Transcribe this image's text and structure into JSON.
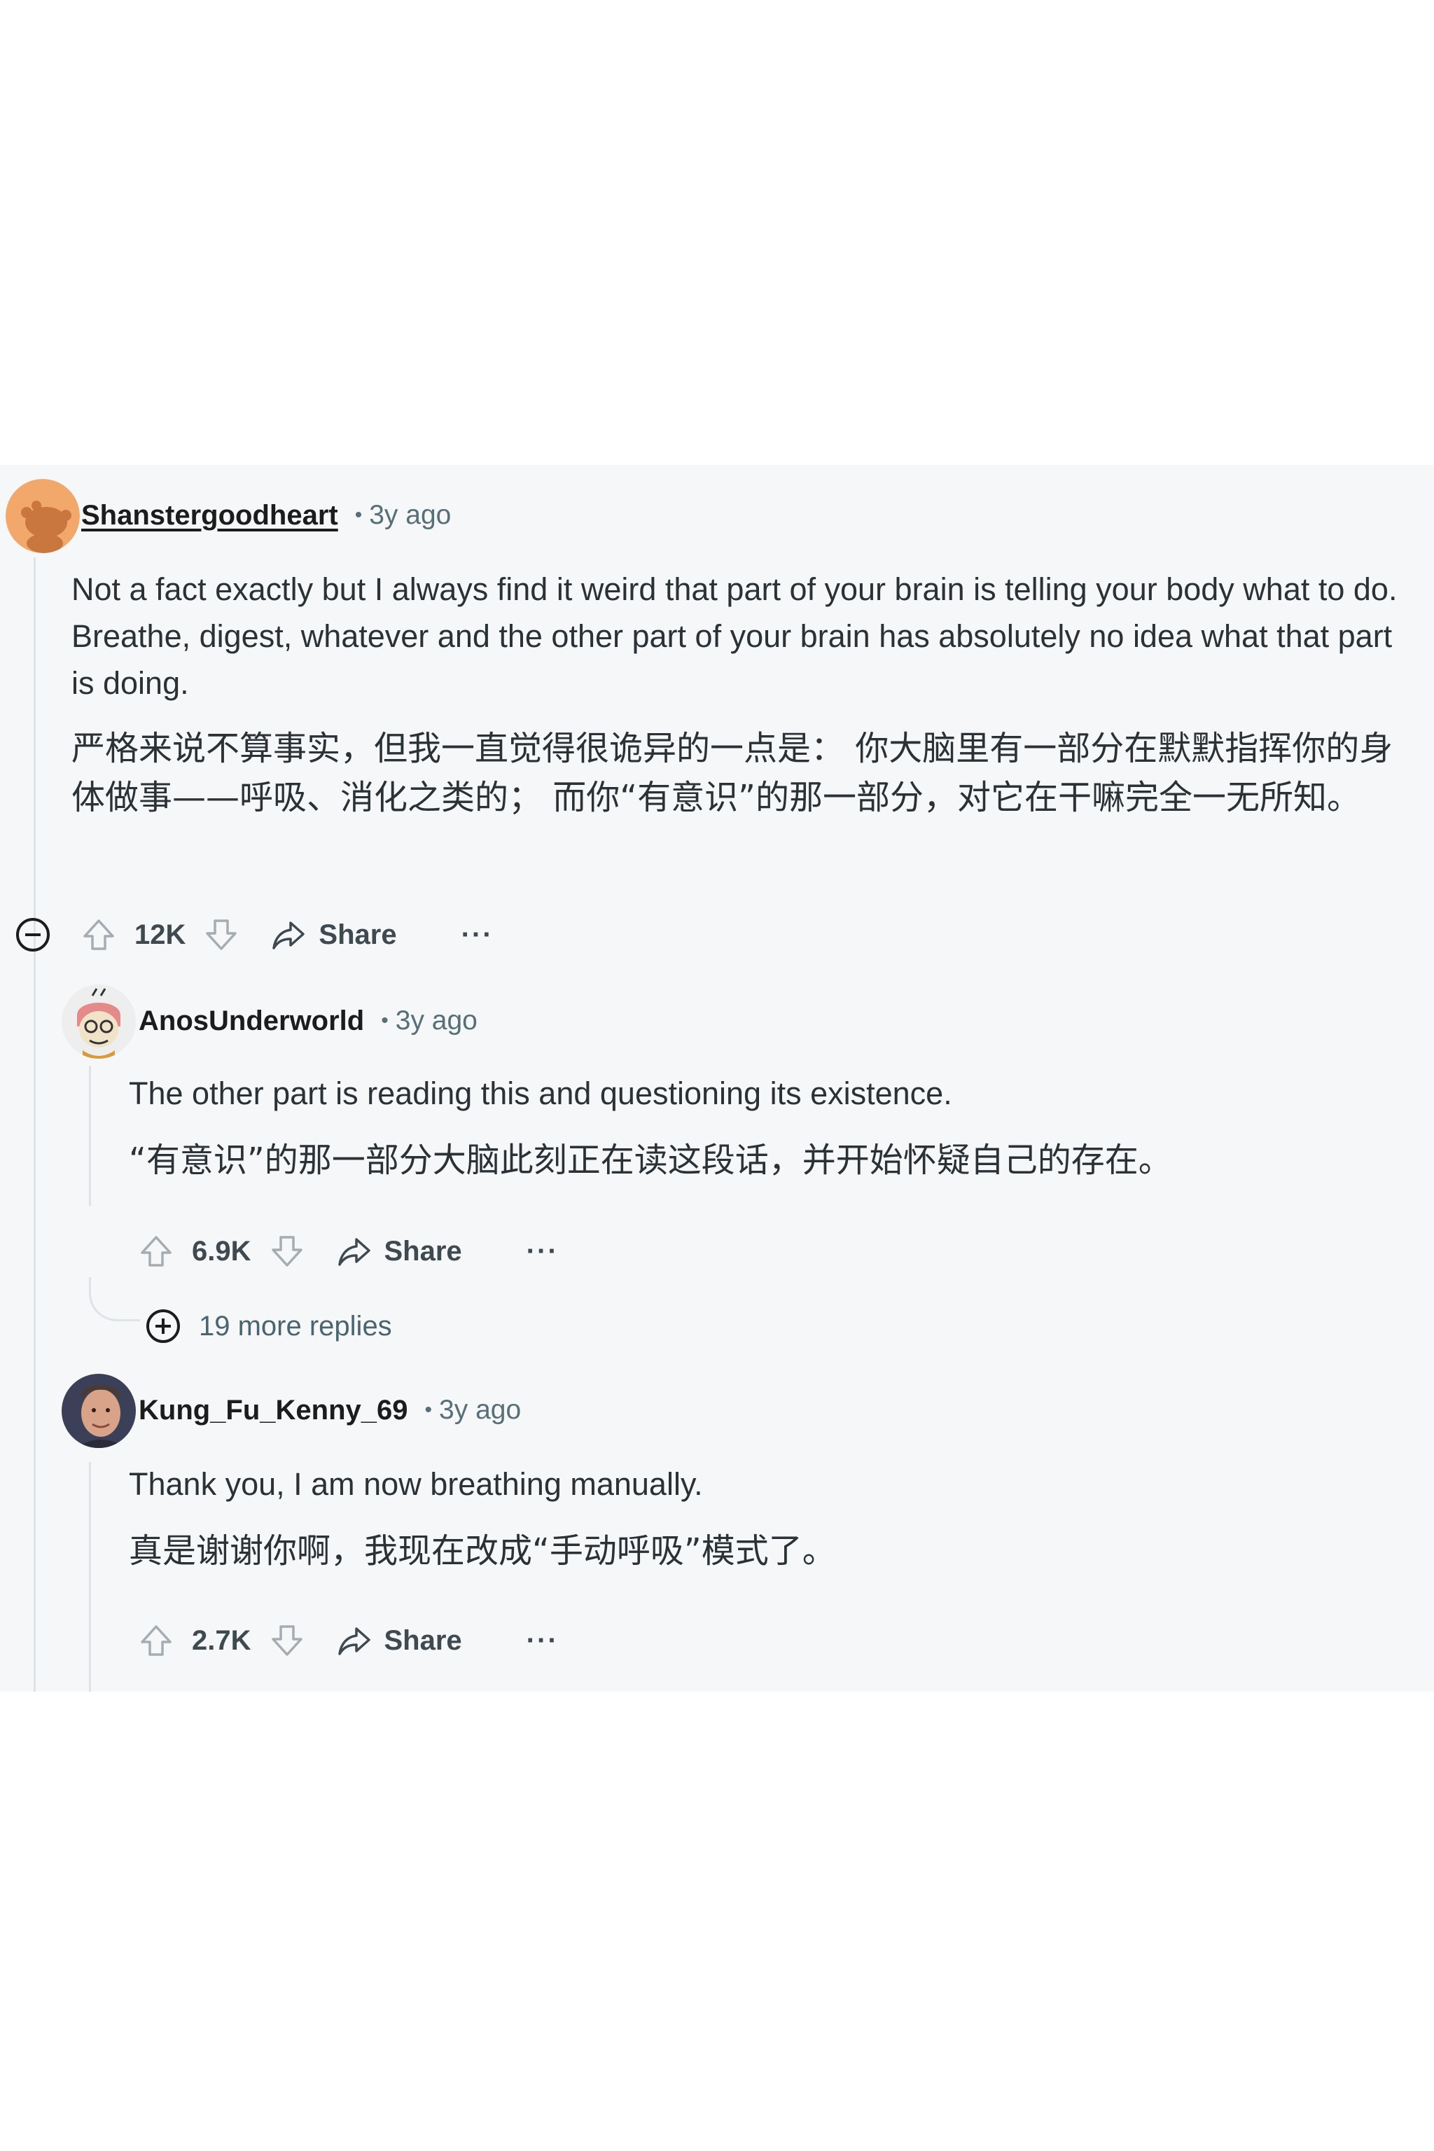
{
  "comments": [
    {
      "username": "Shanstergoodheart",
      "separator": "•",
      "time": "3y ago",
      "text_en": "Not a fact exactly but I always find it weird that part of your brain is telling your body what to do. Breathe, digest, whatever and the other part of your brain has absolutely no idea what that part is doing.",
      "text_zh": "严格来说不算事实，但我一直觉得很诡异的一点是： 你大脑里有一部分在默默指挥你的身体做事——呼吸、消化之类的； 而你“有意识”的那一部分，对它在干嘛完全一无所知。",
      "votes": "12K",
      "share_label": "Share",
      "more_label": "···"
    },
    {
      "username": "AnosUnderworld",
      "separator": "•",
      "time": "3y ago",
      "text_en": "The other part is reading this and questioning its existence.",
      "text_zh": "“有意识”的那一部分大脑此刻正在读这段话，并开始怀疑自己的存在。",
      "votes": "6.9K",
      "share_label": "Share",
      "more_label": "···",
      "more_replies": "19 more replies"
    },
    {
      "username": "Kung_Fu_Kenny_69",
      "separator": "•",
      "time": "3y ago",
      "text_en": "Thank you, I am now breathing manually.",
      "text_zh": "真是谢谢你啊，我现在改成“手动呼吸”模式了。",
      "votes": "2.7K",
      "share_label": "Share",
      "more_label": "···"
    }
  ],
  "colors": {
    "background": "#f6f7f8",
    "text": "#2a3236",
    "meta": "#576f76",
    "thread_line": "#dde3e6"
  }
}
